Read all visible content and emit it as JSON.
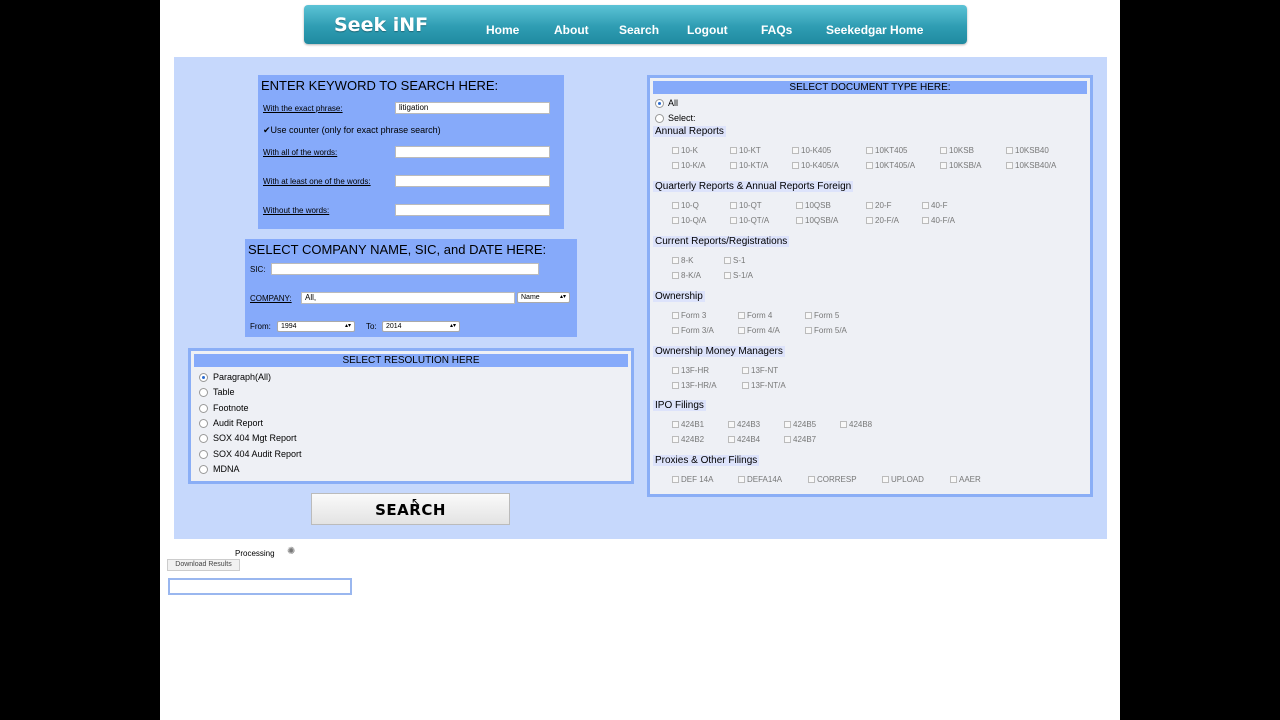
{
  "header": {
    "brand": "Seek iNF",
    "nav": [
      "Home",
      "About",
      "Search",
      "Logout",
      "FAQs",
      "Seekedgar Home"
    ]
  },
  "keyword": {
    "title": "ENTER KEYWORD TO SEARCH HERE:",
    "exact_label": "With the exact phrase:",
    "exact_value": "litigation",
    "counter_label": "Use counter (only for exact phrase search)",
    "all_label": "With all of the words:",
    "one_label": "With at least one of the words:",
    "without_label": "Without the words:"
  },
  "company": {
    "title": "SELECT COMPANY NAME, SIC, and DATE HERE:",
    "sic_label": "SIC:",
    "company_label": "COMPANY:",
    "company_value": "All,",
    "name_select": "Name",
    "from_label": "From:",
    "from_value": "1994",
    "to_label": "To:",
    "to_value": "2014"
  },
  "resolution": {
    "title": "SELECT RESOLUTION HERE",
    "options": [
      "Paragraph(All)",
      "Table",
      "Footnote",
      "Audit Report",
      "SOX 404 Mgt Report",
      "SOX 404 Audit Report",
      "MDNA"
    ],
    "selected": "Paragraph(All)"
  },
  "search_label": "SEARCH",
  "doc": {
    "title": "SELECT DOCUMENT TYPE HERE:",
    "all_label": "All",
    "select_label": "Select:",
    "sections": {
      "annual": {
        "title": "Annual Reports",
        "items": [
          "10-K",
          "10-KT",
          "10-K405",
          "10KT405",
          "10KSB",
          "10KSB40",
          "10-K/A",
          "10-KT/A",
          "10-K405/A",
          "10KT405/A",
          "10KSB/A",
          "10KSB40/A"
        ]
      },
      "quarterly": {
        "title": "Quarterly Reports & Annual Reports Foreign",
        "items": [
          "10-Q",
          "10-QT",
          "10QSB",
          "20-F",
          "40-F",
          "10-Q/A",
          "10-QT/A",
          "10QSB/A",
          "20-F/A",
          "40-F/A"
        ]
      },
      "current": {
        "title": "Current Reports/Registrations",
        "items": [
          "8-K",
          "S-1",
          "8-K/A",
          "S-1/A"
        ]
      },
      "ownership": {
        "title": "Ownership",
        "items": [
          "Form 3",
          "Form 4",
          "Form 5",
          "Form 3/A",
          "Form 4/A",
          "Form 5/A"
        ]
      },
      "money": {
        "title": "Ownership Money Managers",
        "items": [
          "13F-HR",
          "13F-NT",
          "13F-HR/A",
          "13F-NT/A"
        ]
      },
      "ipo": {
        "title": "IPO Filings",
        "items": [
          "424B1",
          "424B3",
          "424B5",
          "424B8",
          "424B2",
          "424B4",
          "424B7"
        ]
      },
      "proxies": {
        "title": "Proxies & Other Filings",
        "items": [
          "DEF 14A",
          "DEFA14A",
          "CORRESP",
          "UPLOAD",
          "AAER"
        ]
      }
    }
  },
  "processing_label": "Processing",
  "download_label": "Download Results"
}
